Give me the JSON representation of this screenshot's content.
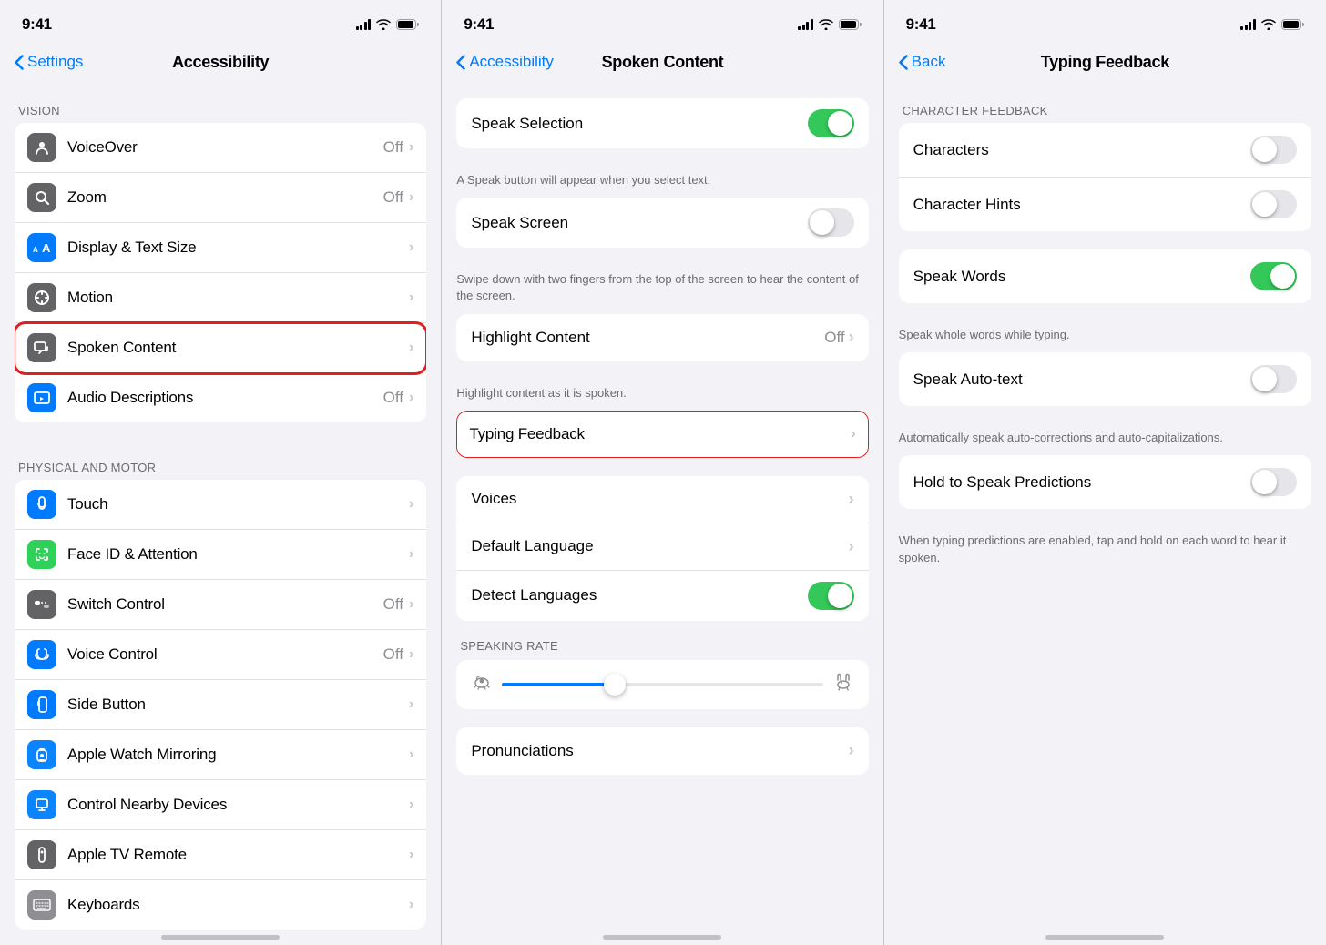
{
  "panel1": {
    "statusTime": "9:41",
    "navBack": "Settings",
    "navTitle": "Accessibility",
    "sections": [
      {
        "header": "VISION",
        "items": [
          {
            "id": "voiceover",
            "label": "VoiceOver",
            "value": "Off",
            "hasChevron": true,
            "iconBg": "#636366",
            "iconType": "voiceover"
          },
          {
            "id": "zoom",
            "label": "Zoom",
            "value": "Off",
            "hasChevron": true,
            "iconBg": "#636366",
            "iconType": "zoom"
          },
          {
            "id": "display",
            "label": "Display & Text Size",
            "value": "",
            "hasChevron": true,
            "iconBg": "#007aff",
            "iconType": "aa"
          },
          {
            "id": "motion",
            "label": "Motion",
            "value": "",
            "hasChevron": true,
            "iconBg": "#636366",
            "iconType": "motion"
          },
          {
            "id": "spoken",
            "label": "Spoken Content",
            "value": "",
            "hasChevron": true,
            "iconBg": "#636366",
            "iconType": "spoken",
            "highlighted": true
          },
          {
            "id": "audio",
            "label": "Audio Descriptions",
            "value": "Off",
            "hasChevron": true,
            "iconBg": "#007aff",
            "iconType": "audio"
          }
        ]
      },
      {
        "header": "PHYSICAL AND MOTOR",
        "items": [
          {
            "id": "touch",
            "label": "Touch",
            "value": "",
            "hasChevron": true,
            "iconBg": "#007aff",
            "iconType": "touch"
          },
          {
            "id": "faceid",
            "label": "Face ID & Attention",
            "value": "",
            "hasChevron": true,
            "iconBg": "#30d158",
            "iconType": "faceid"
          },
          {
            "id": "switch",
            "label": "Switch Control",
            "value": "Off",
            "hasChevron": true,
            "iconBg": "#636366",
            "iconType": "switch"
          },
          {
            "id": "voice",
            "label": "Voice Control",
            "value": "Off",
            "hasChevron": true,
            "iconBg": "#007aff",
            "iconType": "voice"
          },
          {
            "id": "side",
            "label": "Side Button",
            "value": "",
            "hasChevron": true,
            "iconBg": "#007aff",
            "iconType": "side"
          },
          {
            "id": "watch",
            "label": "Apple Watch Mirroring",
            "value": "",
            "hasChevron": true,
            "iconBg": "#0a84ff",
            "iconType": "watch"
          },
          {
            "id": "nearby",
            "label": "Control Nearby Devices",
            "value": "",
            "hasChevron": true,
            "iconBg": "#0a84ff",
            "iconType": "nearby"
          },
          {
            "id": "tvremote",
            "label": "Apple TV Remote",
            "value": "",
            "hasChevron": true,
            "iconBg": "#636366",
            "iconType": "tv"
          },
          {
            "id": "keyboards",
            "label": "Keyboards",
            "value": "",
            "hasChevron": true,
            "iconBg": "#8e8e93",
            "iconType": "keyboards"
          }
        ]
      }
    ]
  },
  "panel2": {
    "statusTime": "9:41",
    "navBack": "Accessibility",
    "navTitle": "Spoken Content",
    "items": [
      {
        "id": "speak-selection",
        "label": "Speak Selection",
        "toggle": true,
        "on": true,
        "subtext": "A Speak button will appear when you select text."
      },
      {
        "id": "speak-screen",
        "label": "Speak Screen",
        "toggle": true,
        "on": false,
        "subtext": "Swipe down with two fingers from the top of the screen to hear the content of the screen."
      },
      {
        "id": "highlight",
        "label": "Highlight Content",
        "value": "Off",
        "hasChevron": true,
        "subtext": "Highlight content as it is spoken."
      },
      {
        "id": "typing",
        "label": "Typing Feedback",
        "hasChevron": true,
        "highlighted": true
      },
      {
        "id": "voices",
        "label": "Voices",
        "hasChevron": true
      },
      {
        "id": "default-lang",
        "label": "Default Language",
        "hasChevron": true
      },
      {
        "id": "detect-lang",
        "label": "Detect Languages",
        "toggle": true,
        "on": true
      }
    ],
    "speakingRateHeader": "SPEAKING RATE",
    "pronunciationsLabel": "Pronunciations"
  },
  "panel3": {
    "statusTime": "9:41",
    "navBack": "Back",
    "navTitle": "Typing Feedback",
    "charFeedbackHeader": "CHARACTER FEEDBACK",
    "items": [
      {
        "id": "characters",
        "label": "Characters",
        "toggle": true,
        "on": false
      },
      {
        "id": "char-hints",
        "label": "Character Hints",
        "toggle": true,
        "on": false
      },
      {
        "id": "speak-words",
        "label": "Speak Words",
        "toggle": true,
        "on": true,
        "subtext": "Speak whole words while typing."
      },
      {
        "id": "speak-autotext",
        "label": "Speak Auto-text",
        "toggle": true,
        "on": false,
        "subtext": "Automatically speak auto-corrections and auto-capitalizations."
      },
      {
        "id": "hold-speak",
        "label": "Hold to Speak Predictions",
        "toggle": true,
        "on": false,
        "subtext": "When typing predictions are enabled, tap and hold on each word to hear it spoken."
      }
    ]
  }
}
